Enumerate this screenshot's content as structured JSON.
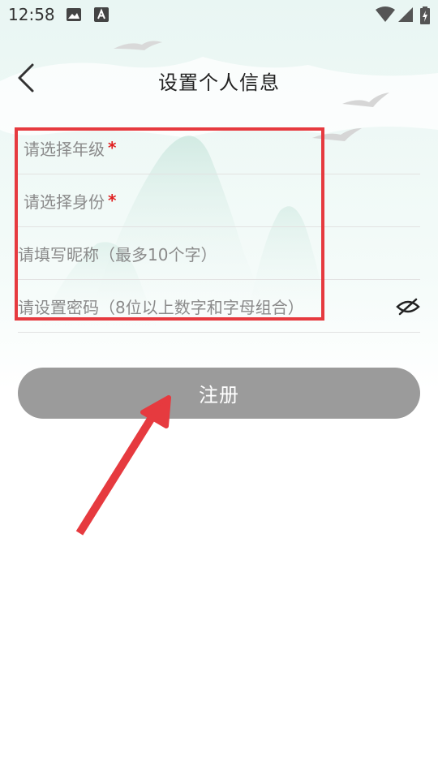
{
  "status_bar": {
    "time": "12:58"
  },
  "header": {
    "title": "设置个人信息"
  },
  "form": {
    "grade_placeholder": "请选择年级",
    "identity_placeholder": "请选择身份",
    "required_mark": "*",
    "nickname_placeholder": "请填写昵称（最多10个字）",
    "password_placeholder": "请设置密码（8位以上数字和字母组合）"
  },
  "actions": {
    "register_label": "注册"
  },
  "colors": {
    "highlight": "#e63a3f",
    "button_bg": "#9b9b9b",
    "required": "#e02020"
  },
  "icons": {
    "back": "chevron-left-icon",
    "password_toggle": "eye-off-icon"
  }
}
